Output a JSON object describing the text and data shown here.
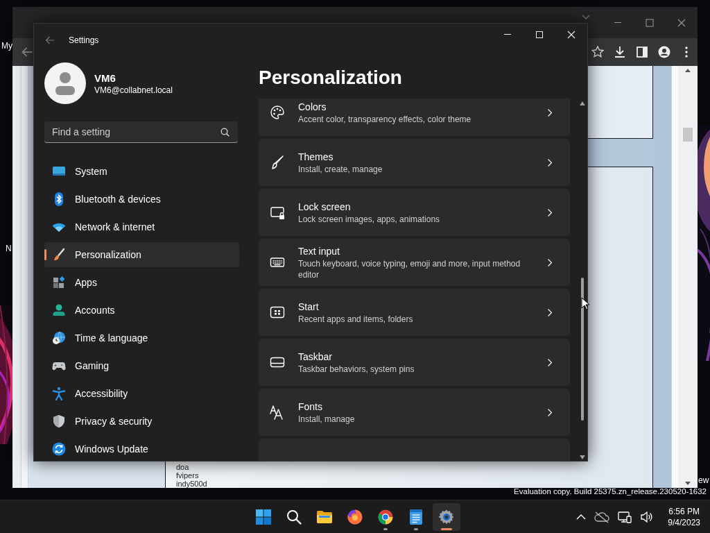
{
  "desktop": {
    "labels": [
      "My",
      "N",
      "ew"
    ],
    "build_notice": "Evaluation copy. Build 25375.zn_release.230520-1632"
  },
  "browser": {
    "page_lines": [
      "doa",
      "fvipers",
      "indy500d"
    ]
  },
  "settings": {
    "title": "Settings",
    "user": {
      "name": "VM6",
      "email": "VM6@collabnet.local"
    },
    "search": {
      "placeholder": "Find a setting"
    },
    "nav": [
      {
        "label": "System",
        "selected": false
      },
      {
        "label": "Bluetooth & devices",
        "selected": false
      },
      {
        "label": "Network & internet",
        "selected": false
      },
      {
        "label": "Personalization",
        "selected": true
      },
      {
        "label": "Apps",
        "selected": false
      },
      {
        "label": "Accounts",
        "selected": false
      },
      {
        "label": "Time & language",
        "selected": false
      },
      {
        "label": "Gaming",
        "selected": false
      },
      {
        "label": "Accessibility",
        "selected": false
      },
      {
        "label": "Privacy & security",
        "selected": false
      },
      {
        "label": "Windows Update",
        "selected": false
      }
    ],
    "heading": "Personalization",
    "cards": [
      {
        "title": "Colors",
        "subtitle": "Accent color, transparency effects, color theme"
      },
      {
        "title": "Themes",
        "subtitle": "Install, create, manage"
      },
      {
        "title": "Lock screen",
        "subtitle": "Lock screen images, apps, animations"
      },
      {
        "title": "Text input",
        "subtitle": "Touch keyboard, voice typing, emoji and more, input method editor"
      },
      {
        "title": "Start",
        "subtitle": "Recent apps and items, folders"
      },
      {
        "title": "Taskbar",
        "subtitle": "Taskbar behaviors, system pins"
      },
      {
        "title": "Fonts",
        "subtitle": "Install, manage"
      }
    ]
  },
  "taskbar": {
    "apps": [
      {
        "running": false,
        "active": false
      },
      {
        "running": false,
        "active": false
      },
      {
        "running": false,
        "active": false
      },
      {
        "running": false,
        "active": false
      },
      {
        "running": true,
        "active": false
      },
      {
        "running": true,
        "active": false
      },
      {
        "running": true,
        "active": true
      }
    ],
    "clock": {
      "time": "6:56 PM",
      "date": "9/4/2023"
    }
  }
}
